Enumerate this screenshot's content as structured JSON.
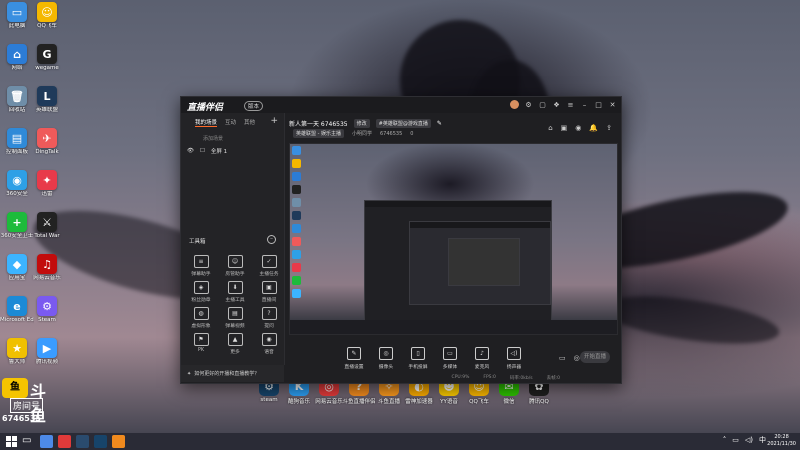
{
  "desktop": {
    "icons_col1": [
      {
        "label": "此电脑",
        "color": "#3a8fe0",
        "glyph": "▭"
      },
      {
        "label": "网络",
        "color": "#2c7cd6",
        "glyph": "⌂"
      },
      {
        "label": "回收站",
        "color": "#6f8ea8",
        "glyph": "🗑"
      },
      {
        "label": "控制面板",
        "color": "#2f8ad8",
        "glyph": "▤"
      },
      {
        "label": "360安全",
        "color": "#2ea0e6",
        "glyph": "◉"
      },
      {
        "label": "360安全卫士",
        "color": "#1dbb3b",
        "glyph": "+"
      },
      {
        "label": "应用宝",
        "color": "#3cb4ff",
        "glyph": "◆"
      },
      {
        "label": "Microsoft Edge",
        "color": "#1c8ad6",
        "glyph": "e"
      },
      {
        "label": "鲁大师",
        "color": "#f0c000",
        "glyph": "★"
      }
    ],
    "icons_col2": [
      {
        "label": "QQ飞车",
        "color": "#f5b800",
        "glyph": "☺"
      },
      {
        "label": "wegame",
        "color": "#222222",
        "glyph": "G"
      },
      {
        "label": "英雄联盟",
        "color": "#1f3a5a",
        "glyph": "L"
      },
      {
        "label": "DingTalk",
        "color": "#ef5a5a",
        "glyph": "✈"
      },
      {
        "label": "迅雷",
        "color": "#e83a4a",
        "glyph": "✦"
      },
      {
        "label": "Total War",
        "color": "#222222",
        "glyph": "⚔"
      },
      {
        "label": "网易云音乐",
        "color": "#c20c0c",
        "glyph": "♫"
      },
      {
        "label": "Steam",
        "color": "#7a5af0",
        "glyph": "⚙"
      },
      {
        "label": "腾讯视频",
        "color": "#3a9cff",
        "glyph": "▶"
      }
    ],
    "bottom_icons": [
      {
        "label": "steam",
        "color": "#17446a",
        "glyph": "⚙"
      },
      {
        "label": "酷狗音乐",
        "color": "#2b9cf0",
        "glyph": "K"
      },
      {
        "label": "网易云音乐",
        "color": "#e23a3a",
        "glyph": "◎"
      },
      {
        "label": "斗鱼直播伴侣",
        "color": "#f08a1e",
        "glyph": "?"
      },
      {
        "label": "斗鱼直播",
        "color": "#f5961e",
        "glyph": "✧"
      },
      {
        "label": "雷神加速器",
        "color": "#f7a800",
        "glyph": "◐"
      },
      {
        "label": "YY语音",
        "color": "#f6c700",
        "glyph": "☻"
      },
      {
        "label": "QQ飞车",
        "color": "#f6b400",
        "glyph": "☺"
      },
      {
        "label": "微信",
        "color": "#2dc100",
        "glyph": "✉"
      },
      {
        "label": "腾讯QQ",
        "color": "#1e1e1e",
        "glyph": "✿"
      }
    ]
  },
  "stamp": {
    "brand": "斗鱼",
    "room_label": "房间号",
    "room_number": "6746535"
  },
  "window": {
    "app_name": "直播伴侣",
    "version": "版本",
    "sidebar": {
      "tabs": [
        "我的场景",
        "互动",
        "其他"
      ],
      "add_scene": "添加场景",
      "scene_name": "全屏 1",
      "tools_title": "工具箱",
      "tools": [
        {
          "label": "弹幕助手",
          "glyph": "≡"
        },
        {
          "label": "房管助手",
          "glyph": "☺"
        },
        {
          "label": "主播任务",
          "glyph": "✓"
        },
        {
          "label": "粉丝勋章",
          "glyph": "◈"
        },
        {
          "label": "主播工具",
          "glyph": "⬇"
        },
        {
          "label": "直播间",
          "glyph": "▣"
        },
        {
          "label": "虚拟形象",
          "glyph": "◍"
        },
        {
          "label": "弹幕视频",
          "glyph": "▤"
        },
        {
          "label": "提问",
          "glyph": "?"
        },
        {
          "label": "PK",
          "glyph": "⚑"
        },
        {
          "label": "更多",
          "glyph": "▲"
        },
        {
          "label": "语音",
          "glyph": "◉"
        }
      ],
      "notice": "如何更好的开播和直播教学？"
    },
    "header": {
      "title": "新人第一天 6746535",
      "chip": "修改",
      "tag": "#英雄联盟@游戏直播",
      "category": "英雄联盟 - 娱乐主播",
      "streamer": "小明同学",
      "room_id": "6746535",
      "fans": "0"
    },
    "bottom": [
      {
        "label": "直播设置",
        "glyph": "✎"
      },
      {
        "label": "摄像头",
        "glyph": "◎"
      },
      {
        "label": "手机投屏",
        "glyph": "▯"
      },
      {
        "label": "多媒体",
        "glyph": "▭"
      },
      {
        "label": "麦克风",
        "glyph": "♪"
      },
      {
        "label": "扬声器",
        "glyph": "◁)"
      }
    ],
    "live_button": "开始直播",
    "stats": [
      "CPU:9%",
      "FPS:0",
      "码率:0kb/s",
      "丢帧:0"
    ]
  },
  "taskbar": {
    "time": "20:28",
    "date": "2021/11/30"
  }
}
